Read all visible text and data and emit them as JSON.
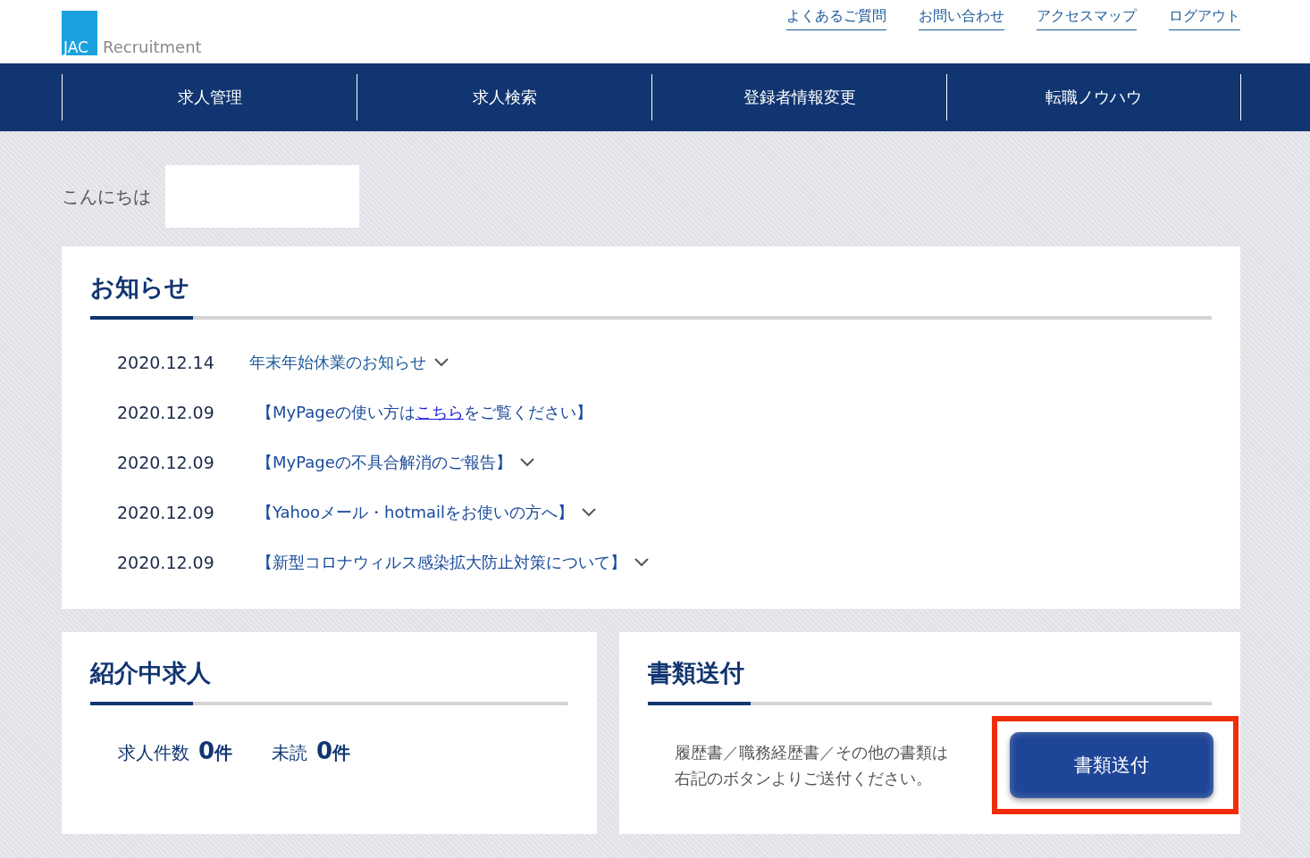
{
  "logo": {
    "mark": "JAC",
    "wordmark": "Recruitment"
  },
  "top_links": [
    "よくあるご質問",
    "お問い合わせ",
    "アクセスマップ",
    "ログアウト"
  ],
  "nav": [
    "求人管理",
    "求人検索",
    "登録者情報変更",
    "転職ノウハウ"
  ],
  "greeting": "こんにちは",
  "notices": {
    "title": "お知らせ",
    "items": [
      {
        "date": "2020.12.14",
        "text": "年末年始休業のお知らせ",
        "expandable": true
      },
      {
        "date": "2020.12.09",
        "text": "【MyPageの使い方は",
        "link": "こちら",
        "after": "をご覧ください】",
        "expandable": false
      },
      {
        "date": "2020.12.09",
        "text": "【MyPageの不具合解消のご報告】",
        "expandable": true
      },
      {
        "date": "2020.12.09",
        "text": "【Yahooメール・hotmailをお使いの方へ】",
        "expandable": true
      },
      {
        "date": "2020.12.09",
        "text": "【新型コロナウィルス感染拡大防止対策について】",
        "expandable": true
      }
    ]
  },
  "jobs": {
    "title": "紹介中求人",
    "stats": [
      {
        "label": "求人件数",
        "value": "0",
        "unit": "件"
      },
      {
        "label": "未読",
        "value": "0",
        "unit": "件"
      }
    ]
  },
  "documents": {
    "title": "書類送付",
    "description": [
      "履歴書／職務経歴書／その他の書類は",
      "右記のボタンよりご送付ください。"
    ],
    "button": "書類送付",
    "highlighted": true
  }
}
